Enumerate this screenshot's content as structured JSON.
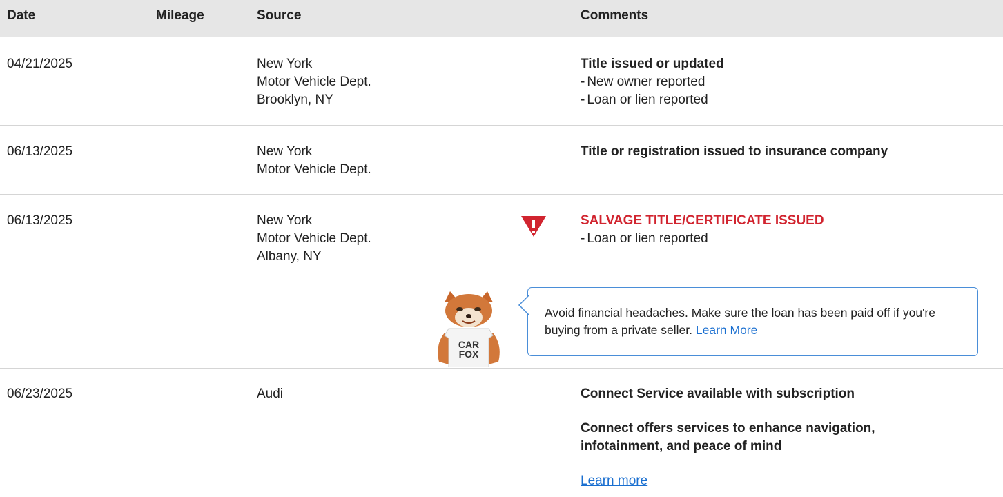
{
  "header": {
    "date": "Date",
    "mileage": "Mileage",
    "source": "Source",
    "comments": "Comments"
  },
  "rows": [
    {
      "date": "04/21/2025",
      "source": [
        "New York",
        "Motor Vehicle Dept.",
        "Brooklyn, NY"
      ],
      "comment_title": "Title issued or updated",
      "comment_items": [
        "New owner reported",
        "Loan or lien reported"
      ]
    },
    {
      "date": "06/13/2025",
      "source": [
        "New York",
        "Motor Vehicle Dept."
      ],
      "comment_title": "Title or registration issued to insurance company"
    },
    {
      "date": "06/13/2025",
      "source": [
        "New York",
        "Motor Vehicle Dept.",
        "Albany, NY"
      ],
      "comment_title": "SALVAGE TITLE/CERTIFICATE ISSUED",
      "comment_items": [
        "Loan or lien reported"
      ],
      "tip": {
        "text": "Avoid financial headaches. Make sure the loan has been paid off if you're buying from a private seller.",
        "link": "Learn More"
      },
      "mascot_shirt": [
        "CAR",
        "FOX"
      ]
    },
    {
      "date": "06/23/2025",
      "source": [
        "Audi"
      ],
      "comment_title": "Connect Service available with subscription",
      "comment_body": "Connect offers services to enhance navigation, infotainment, and peace of mind",
      "comment_link": "Learn more"
    }
  ],
  "colors": {
    "header_bg": "#e6e6e6",
    "alert_red": "#d1242f",
    "link_blue": "#1a6fd0",
    "bubble_border": "#4a8ed8"
  },
  "icons": {
    "alert": "warning-triangle-icon",
    "mascot": "carfox-mascot"
  }
}
